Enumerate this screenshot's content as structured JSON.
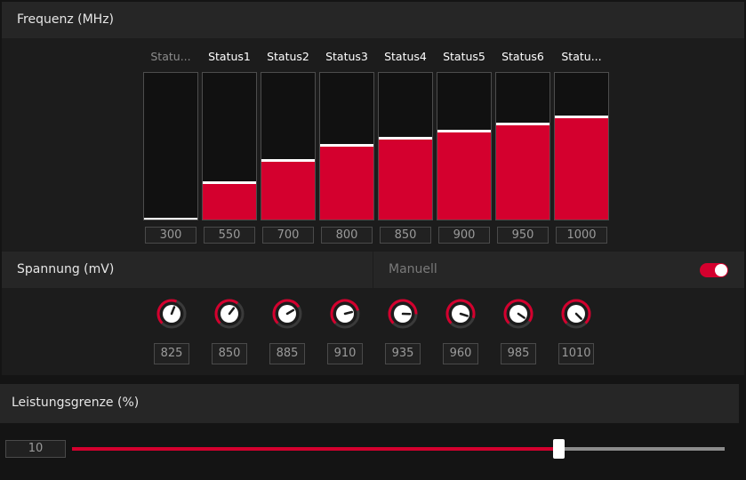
{
  "frequency": {
    "title": "Frequenz (MHz)",
    "states": [
      {
        "label": "Statu...",
        "value": "300",
        "level": 0.0
      },
      {
        "label": "Status1",
        "value": "550",
        "level": 0.25
      },
      {
        "label": "Status2",
        "value": "700",
        "level": 0.4
      },
      {
        "label": "Status3",
        "value": "800",
        "level": 0.5
      },
      {
        "label": "Status4",
        "value": "850",
        "level": 0.55
      },
      {
        "label": "Status5",
        "value": "900",
        "level": 0.6
      },
      {
        "label": "Status6",
        "value": "950",
        "level": 0.65
      },
      {
        "label": "Statu...",
        "value": "1000",
        "level": 0.7
      }
    ]
  },
  "voltage": {
    "title": "Spannung (mV)",
    "mode_label": "Manuell",
    "manual_enabled": true,
    "values": [
      {
        "value": "825",
        "level": 0.58
      },
      {
        "value": "850",
        "level": 0.64
      },
      {
        "value": "885",
        "level": 0.72
      },
      {
        "value": "910",
        "level": 0.78
      },
      {
        "value": "935",
        "level": 0.84
      },
      {
        "value": "960",
        "level": 0.9
      },
      {
        "value": "985",
        "level": 0.96
      },
      {
        "value": "1010",
        "level": 1.0
      }
    ]
  },
  "power_limit": {
    "title": "Leistungsgrenze (%)",
    "value": "10",
    "level": 0.745
  },
  "colors": {
    "accent": "#d4002e",
    "knob_track": "#3a3a3a",
    "panel": "#1c1c1c",
    "header": "#262626"
  },
  "icons": [
    "toggle-switch-icon",
    "voltage-dial-icon"
  ]
}
